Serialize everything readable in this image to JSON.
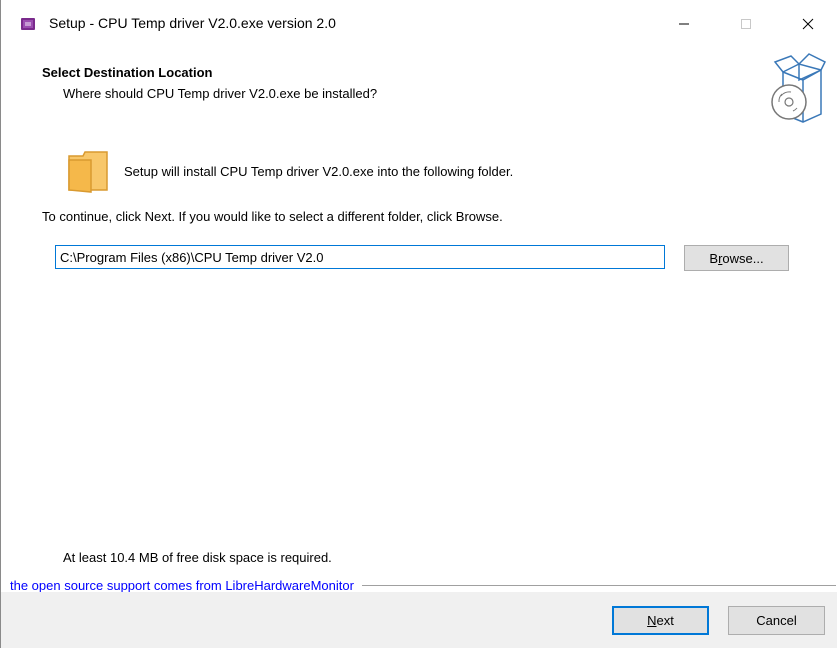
{
  "window": {
    "title": "Setup - CPU Temp driver V2.0.exe version 2.0",
    "minimize_glyph": "—",
    "maximize_glyph": "☐",
    "close_glyph": "✕"
  },
  "header": {
    "title": "Select Destination Location",
    "subtitle": "Where should CPU Temp driver V2.0.exe be installed?"
  },
  "body": {
    "info": "Setup will install CPU Temp driver V2.0.exe into the following folder.",
    "continue_text": "To continue, click Next. If you would like to select a different folder, click Browse.",
    "path_value": "C:\\Program Files (x86)\\CPU Temp driver V2.0",
    "browse_label_pre": "B",
    "browse_label_ul": "r",
    "browse_label_post": "owse...",
    "disk_space": "At least 10.4 MB of free disk space is required."
  },
  "branding": "the open source support comes from LibreHardwareMonitor",
  "footer": {
    "next_label_ul": "N",
    "next_label_post": "ext",
    "cancel_label": "Cancel"
  },
  "colors": {
    "accent": "#0078d7",
    "branding_text": "#0000ff",
    "folder": "#f8c76a",
    "app_icon": "#7a2a8c"
  },
  "icons": {
    "app": "setup-app-icon",
    "header": "box-with-disc-icon",
    "folder": "folder-icon"
  }
}
